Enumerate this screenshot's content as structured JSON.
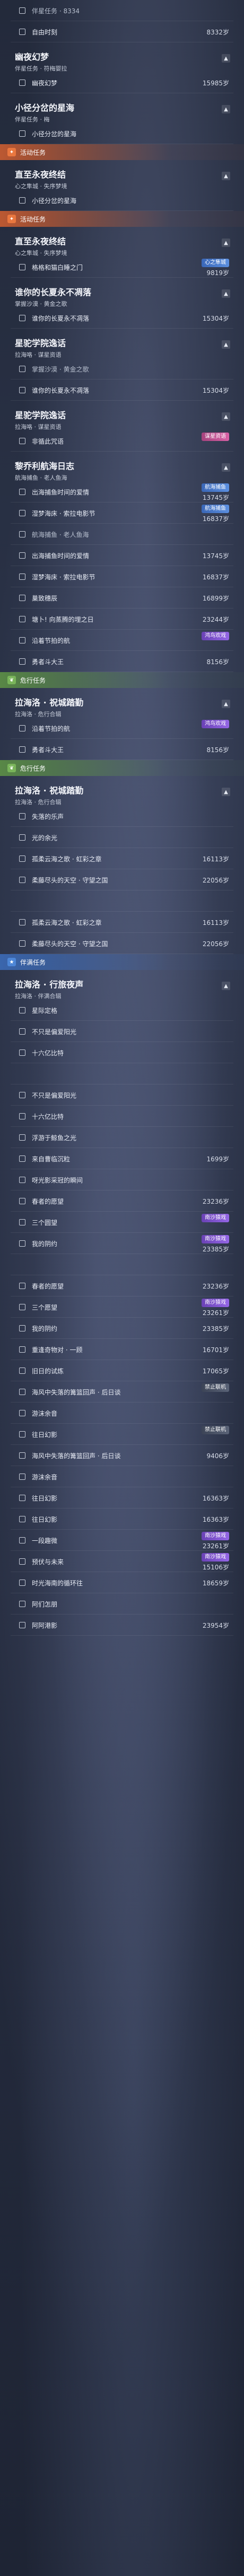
{
  "colors": {
    "activity": "#e9773f",
    "fate": "#79b45a",
    "companion": "#4d86d6",
    "tag_blue": "#4a7bd0",
    "tag_purple": "#7f55d4",
    "tag_pink": "#c2548f"
  },
  "icons": {
    "activity": "sparkle-icon",
    "fate": "leaf-icon",
    "companion": "star-icon",
    "expand": "chevron-up-icon",
    "checkbox": "checkbox-icon"
  },
  "entries": [
    {
      "type": "item",
      "text": "伴星任务 · 8334",
      "value": "",
      "faded": true
    },
    {
      "type": "item",
      "text": "自由时刻",
      "value": "8332岁"
    },
    {
      "type": "group",
      "title": "幽夜幻梦",
      "sub": "伴星任务 · 符梅婴拉"
    },
    {
      "type": "item",
      "text": "幽夜幻梦",
      "value": "15985岁"
    },
    {
      "type": "group",
      "title": "小径分岔的星海",
      "sub": "伴星任务 · 梅"
    },
    {
      "type": "item",
      "text": "小径分岔的星海",
      "value": ""
    },
    {
      "type": "section",
      "label": "活动任务",
      "color": "orange"
    },
    {
      "type": "group",
      "title": "直至永夜终结",
      "sub": "心之隼城 · 失序梦境"
    },
    {
      "type": "item",
      "text": "小径分岔的星海",
      "value": ""
    },
    {
      "type": "section",
      "label": "活动任务",
      "color": "orange"
    },
    {
      "type": "group",
      "title": "直至永夜终结",
      "sub": "心之隼城 · 失序梦境"
    },
    {
      "type": "item",
      "text": "格格和猫白睡之门",
      "value": "9819岁",
      "tag": "心之隼城",
      "tagColor": "blue"
    },
    {
      "type": "group",
      "title": "谁你的长夏永不凋落",
      "sub": "掌握沙漠 · 黄金之歌"
    },
    {
      "type": "item",
      "text": "谁你的长夏永不凋落",
      "value": "15304岁"
    },
    {
      "type": "group",
      "title": "星驼学院逸话",
      "sub": "拉海咯 · 谋星资语"
    },
    {
      "type": "item",
      "text": "掌握沙漠 · 黄金之歌",
      "value": "",
      "dim": true
    },
    {
      "type": "item",
      "text": "谁你的长夏永不凋落",
      "value": "15304岁"
    },
    {
      "type": "group",
      "title": "星驼学院逸话",
      "sub": "拉海咯 · 谋星资语"
    },
    {
      "type": "item",
      "text": "非循此咒语",
      "value": "",
      "tag": "谋星资语",
      "tagColor": "pink"
    },
    {
      "type": "group",
      "title": "黎乔利航海日志",
      "sub": "航海捕鱼 · 老人鱼海"
    },
    {
      "type": "item",
      "text": "出海捕鱼时间的爱情",
      "value": "13745岁",
      "tag": "航海捕鱼",
      "tagColor": "blue"
    },
    {
      "type": "item",
      "text": "湿梦海床 · 索拉电影节",
      "value": "16837岁",
      "tag": "航海捕鱼",
      "tagColor": "blue"
    },
    {
      "type": "item",
      "text": "航海捕鱼 · 老人鱼海",
      "value": "",
      "dim": true
    },
    {
      "type": "item",
      "text": "出海捕鱼时间的爱情",
      "value": "13745岁"
    },
    {
      "type": "item",
      "text": "湿梦海床 · 索拉电影节",
      "value": "16837岁"
    },
    {
      "type": "item",
      "text": "巢致穗辰",
      "value": "16899岁"
    },
    {
      "type": "item",
      "text": "塘卜! 向蒸腾的埋之日",
      "value": "23244岁"
    },
    {
      "type": "item",
      "text": "沿着节拍的航",
      "value": "",
      "tag": "鸿鸟欢戏",
      "tagColor": "purple"
    },
    {
      "type": "item",
      "text": "勇者斗大王",
      "value": "8156岁"
    },
    {
      "type": "section",
      "label": "危行任务",
      "color": "green"
    },
    {
      "type": "group",
      "title": "拉海洛 · 祝城踏勤",
      "sub": "拉海洛 · 危行合辑"
    },
    {
      "type": "item",
      "text": "沿着节拍的航",
      "value": "",
      "tag": "鸿鸟欢戏",
      "tagColor": "purple"
    },
    {
      "type": "item",
      "text": "勇者斗大王",
      "value": "8156岁"
    },
    {
      "type": "section",
      "label": "危行任务",
      "color": "green"
    },
    {
      "type": "group",
      "title": "拉海洛 · 祝城踏勤",
      "sub": "拉海洛 · 危行合辑"
    },
    {
      "type": "item",
      "text": "失落的乐声",
      "value": ""
    },
    {
      "type": "item",
      "text": "光的余光",
      "value": ""
    },
    {
      "type": "item",
      "text": "孤柔云海之歌 · 虹彩之章",
      "value": "16113岁"
    },
    {
      "type": "item",
      "text": "柔藤尽头的天空 · 守望之国",
      "value": "22056岁"
    },
    {
      "type": "item",
      "text": "",
      "value": "",
      "blank": true
    },
    {
      "type": "item",
      "text": "孤柔云海之歌 · 虹彩之章",
      "value": "16113岁"
    },
    {
      "type": "item",
      "text": "柔藤尽头的天空 · 守望之国",
      "value": "22056岁"
    },
    {
      "type": "section",
      "label": "伴满任务",
      "color": "blue"
    },
    {
      "type": "group",
      "title": "拉海洛 · 行旅夜声",
      "sub": "拉海洛 · 伴满合辑"
    },
    {
      "type": "item",
      "text": "星际定格",
      "value": ""
    },
    {
      "type": "item",
      "text": "不只是偏爱阳光",
      "value": ""
    },
    {
      "type": "item",
      "text": "十六亿比特",
      "value": ""
    },
    {
      "type": "item",
      "text": "",
      "value": "",
      "blank": true
    },
    {
      "type": "item",
      "text": "不只是偏爱阳光",
      "value": ""
    },
    {
      "type": "item",
      "text": "十六亿比特",
      "value": ""
    },
    {
      "type": "item",
      "text": "浮游于鲸鱼之光",
      "value": ""
    },
    {
      "type": "item",
      "text": "来自曹临沉粒",
      "value": "1699岁"
    },
    {
      "type": "item",
      "text": "呀光影采冠的瞬间",
      "value": ""
    },
    {
      "type": "item",
      "text": "春者的愿望",
      "value": "23236岁"
    },
    {
      "type": "item",
      "text": "三个圆望",
      "value": "",
      "tag": "南沙猿戏",
      "tagColor": "purple"
    },
    {
      "type": "item",
      "text": "我的阴约",
      "value": "23385岁",
      "tag": "南沙猿戏",
      "tagColor": "purple"
    },
    {
      "type": "item",
      "text": "",
      "value": "",
      "blank": true
    },
    {
      "type": "item",
      "text": "春者的愿望",
      "value": "23236岁"
    },
    {
      "type": "item",
      "text": "三个愿望",
      "value": "23261岁",
      "tag": "南沙猿戏",
      "tagColor": "purple"
    },
    {
      "type": "item",
      "text": "我的阴约",
      "value": "23385岁"
    },
    {
      "type": "item",
      "text": "重逢奇物对 · 一顾",
      "value": "16701岁"
    },
    {
      "type": "item",
      "text": "旧日的试炼",
      "value": "17065岁"
    },
    {
      "type": "item",
      "text": "海风中失落的篝篮回声 · 后日谈",
      "value": "",
      "tag": "禁止联机",
      "tagColor": "dark"
    },
    {
      "type": "item",
      "text": "游沫余音",
      "value": ""
    },
    {
      "type": "item",
      "text": "往日幻影",
      "value": "",
      "tag": "禁止联机",
      "tagColor": "dark"
    },
    {
      "type": "item",
      "text": "海风中失落的篝篮回声 · 后日谈",
      "value": "9406岁"
    },
    {
      "type": "item",
      "text": "游沫余音",
      "value": ""
    },
    {
      "type": "item",
      "text": "往日幻影",
      "value": "16363岁"
    },
    {
      "type": "item",
      "text": "往日幻影",
      "value": "16363岁"
    },
    {
      "type": "item",
      "text": "一段趣微",
      "value": "23261岁",
      "tag": "南沙猿戏",
      "tagColor": "purple"
    },
    {
      "type": "item",
      "text": "预伏与未来",
      "value": "15106岁",
      "tag": "南沙猿戏",
      "tagColor": "purple"
    },
    {
      "type": "item",
      "text": "时光海南的循环往",
      "value": "18659岁"
    },
    {
      "type": "item",
      "text": "阿们怎朋",
      "value": ""
    },
    {
      "type": "item",
      "text": "阿阿港影",
      "value": "23954岁"
    }
  ]
}
